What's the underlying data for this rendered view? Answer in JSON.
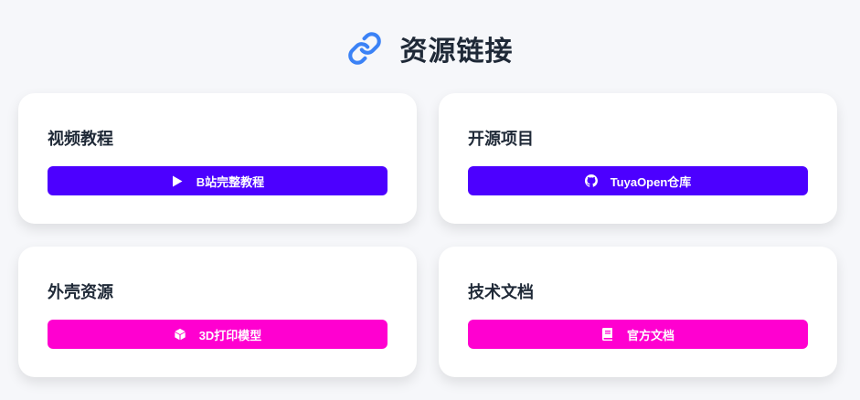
{
  "header": {
    "title": "资源链接",
    "icon": "link-icon",
    "icon_color": "#3b82f6"
  },
  "cards": [
    {
      "title": "视频教程",
      "button": {
        "label": "B站完整教程",
        "icon": "play-icon",
        "color": "#4c00ff"
      }
    },
    {
      "title": "开源项目",
      "button": {
        "label": "TuyaOpen仓库",
        "icon": "github-icon",
        "color": "#4c00ff"
      }
    },
    {
      "title": "外壳资源",
      "button": {
        "label": "3D打印模型",
        "icon": "cube-icon",
        "color": "#ff00d0"
      }
    },
    {
      "title": "技术文档",
      "button": {
        "label": "官方文档",
        "icon": "book-icon",
        "color": "#ff00d0"
      }
    }
  ]
}
